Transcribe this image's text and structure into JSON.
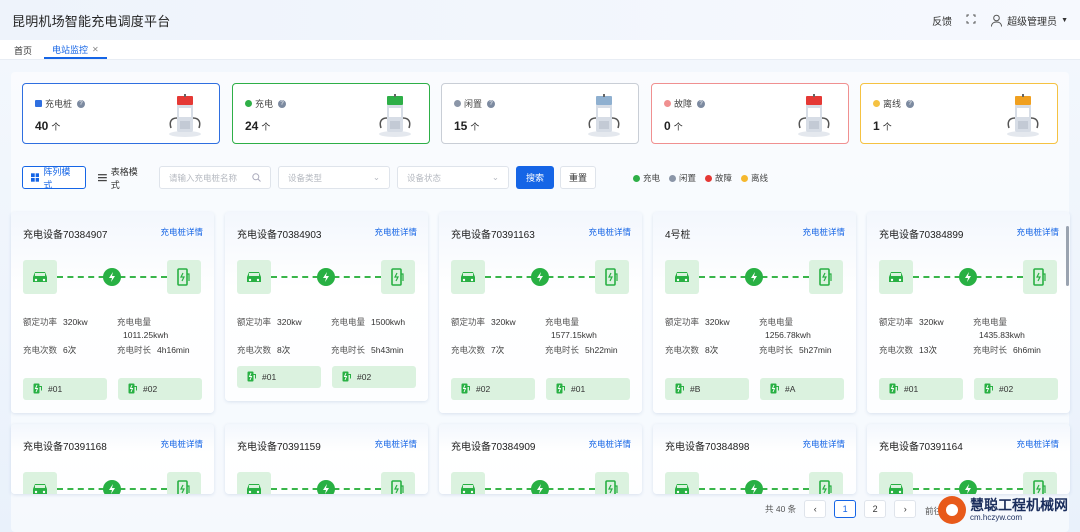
{
  "header": {
    "title": "昆明机场智能充电调度平台",
    "feedback": "反馈",
    "user": "超级管理员"
  },
  "tabs": [
    {
      "label": "首页"
    },
    {
      "label": "电站监控"
    }
  ],
  "stats": [
    {
      "label": "充电桩",
      "value": "40",
      "unit": "个",
      "color": "#2f6fe0",
      "lamp": "#e53935"
    },
    {
      "label": "充电",
      "value": "24",
      "unit": "个",
      "color": "#2eaf47",
      "lamp": "#2eaf47"
    },
    {
      "label": "闲置",
      "value": "15",
      "unit": "个",
      "color": "#c9ced6",
      "lamp": "#8fb0d0"
    },
    {
      "label": "故障",
      "value": "0",
      "unit": "个",
      "color": "#f09090",
      "lamp": "#e53935"
    },
    {
      "label": "离线",
      "value": "1",
      "unit": "个",
      "color": "#f5c242",
      "lamp": "#f0a020"
    }
  ],
  "toolbar": {
    "grid_mode": "阵列模式",
    "table_mode": "表格模式",
    "name_placeholder": "请输入充电桩名称",
    "type_placeholder": "设备类型",
    "status_placeholder": "设备状态",
    "search": "搜索",
    "reset": "重置"
  },
  "legend": [
    {
      "label": "充电",
      "color": "#2eaf47"
    },
    {
      "label": "闲置",
      "color": "#8b96a8"
    },
    {
      "label": "故障",
      "color": "#e53935"
    },
    {
      "label": "离线",
      "color": "#f5b82e"
    }
  ],
  "card_link": "充电桩详情",
  "metric_labels": {
    "power": "额定功率",
    "energy": "充电电量",
    "count": "充电次数",
    "duration": "充电时长"
  },
  "cards": [
    {
      "name": "充电设备70384907",
      "power": "320kw",
      "energy": "1011.25kwh",
      "count": "6次",
      "duration": "4h16min",
      "guns": [
        "#01",
        "#02"
      ]
    },
    {
      "name": "充电设备70384903",
      "power": "320kw",
      "energy": "1500kwh",
      "count": "8次",
      "duration": "5h43min",
      "guns": [
        "#01",
        "#02"
      ]
    },
    {
      "name": "充电设备70391163",
      "power": "320kw",
      "energy": "1577.15kwh",
      "count": "7次",
      "duration": "5h22min",
      "guns": [
        "#02",
        "#01"
      ]
    },
    {
      "name": "4号桩",
      "power": "320kw",
      "energy": "1256.78kwh",
      "count": "8次",
      "duration": "5h27min",
      "guns": [
        "#B",
        "#A"
      ]
    },
    {
      "name": "充电设备70384899",
      "power": "320kw",
      "energy": "1435.83kwh",
      "count": "13次",
      "duration": "6h6min",
      "guns": [
        "#01",
        "#02"
      ]
    }
  ],
  "cards_row2": [
    {
      "name": "充电设备70391168"
    },
    {
      "name": "充电设备70391159"
    },
    {
      "name": "充电设备70384909"
    },
    {
      "name": "充电设备70384898"
    },
    {
      "name": "充电设备70391164"
    }
  ],
  "pagination": {
    "total": "共 40 条",
    "pages": [
      "1",
      "2"
    ],
    "goto": "前往"
  },
  "watermark": {
    "brand": "慧聪工程机械网",
    "url": "cm.hczyw.com"
  }
}
